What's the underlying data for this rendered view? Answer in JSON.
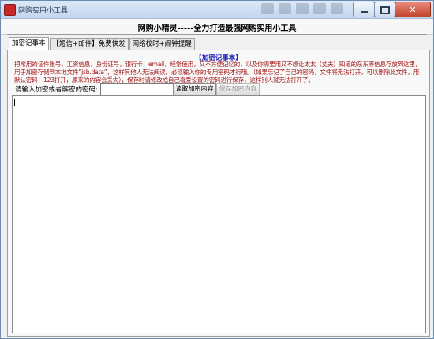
{
  "window": {
    "title": "网购实用小工具",
    "close_glyph": "✕"
  },
  "header": {
    "title": "网购小精灵-----全力打造最强网购实用小工具"
  },
  "tabs": [
    {
      "label": "加密记事本",
      "active": true
    },
    {
      "label": "【短信+邮件】免费快发",
      "active": false
    },
    {
      "label": "网络校时+闹钟提醒",
      "active": false
    }
  ],
  "notepad": {
    "section_title": "【加密记事本】",
    "notice": "把常用的证件账号，工资信息，身份证号，银行卡，email，经常使用，又不方便记忆的，以及你需要用又不想让太太（丈夫）知道的东东等信息存放到这里，用于加密存储到本地文件“jsb.data”，这样其他人无法阅读，必须输入你的专用密码才行哦。（如果忘记了自己的密码，文件将无法打开，可以删除此文件，用默认密码：123打开，原来的内容会丢失），保存时请修改成自己喜爱设置的密码进行保存，这样别人就无法打开了。",
    "password_label": "请输入加密或者解密的密码:",
    "password_value": "",
    "read_button": "读取加密内容",
    "save_button": "保存加密内容",
    "editor_text": ""
  },
  "icons": {
    "app": "app-icon",
    "minimize": "minimize-icon",
    "maximize": "maximize-icon",
    "close": "close-icon"
  }
}
